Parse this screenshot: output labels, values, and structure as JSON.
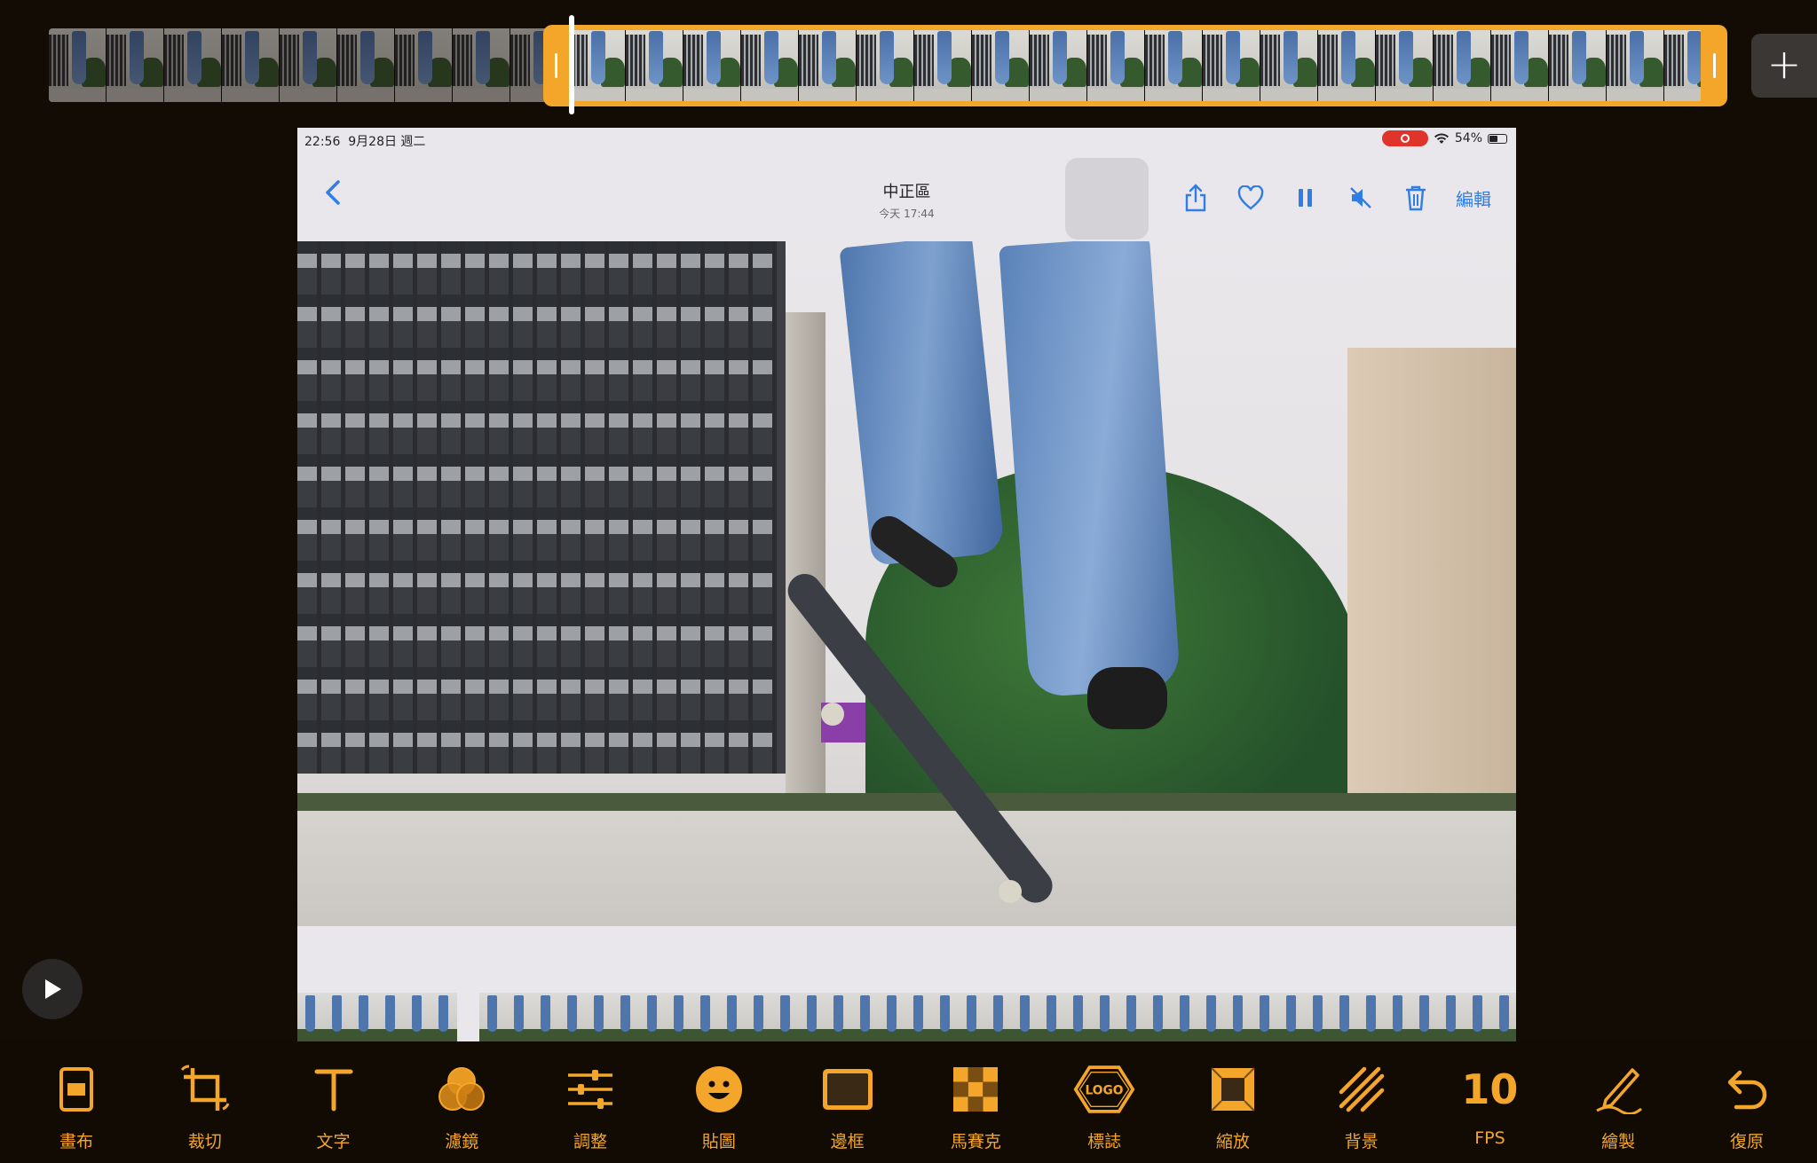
{
  "status_bar": {
    "time": "22:56",
    "date": "9月28日 週二",
    "battery": "54%",
    "battery_level": 0.54
  },
  "photos_nav": {
    "title": "中正區",
    "subtitle": "今天 17:44",
    "edit_label": "編輯"
  },
  "timeline": {
    "add_label": "+"
  },
  "toolbar": {
    "items": [
      {
        "label": "畫布",
        "icon": "canvas-icon"
      },
      {
        "label": "裁切",
        "icon": "crop-icon"
      },
      {
        "label": "文字",
        "icon": "text-icon"
      },
      {
        "label": "濾鏡",
        "icon": "filter-icon"
      },
      {
        "label": "調整",
        "icon": "adjust-sliders-icon"
      },
      {
        "label": "貼圖",
        "icon": "sticker-icon"
      },
      {
        "label": "邊框",
        "icon": "border-icon"
      },
      {
        "label": "馬賽克",
        "icon": "mosaic-icon"
      },
      {
        "label": "標誌",
        "icon": "logo-icon",
        "icon_text": "LOGO"
      },
      {
        "label": "縮放",
        "icon": "zoom-icon"
      },
      {
        "label": "背景",
        "icon": "background-icon"
      },
      {
        "label": "FPS",
        "icon": "fps-icon",
        "value": "10"
      },
      {
        "label": "繪製",
        "icon": "draw-icon"
      },
      {
        "label": "復原",
        "icon": "undo-icon"
      }
    ]
  },
  "colors": {
    "accent": "#f3a62a",
    "background": "#130c05",
    "ios_blue": "#2f7ee6",
    "record_red": "#e0332a"
  }
}
